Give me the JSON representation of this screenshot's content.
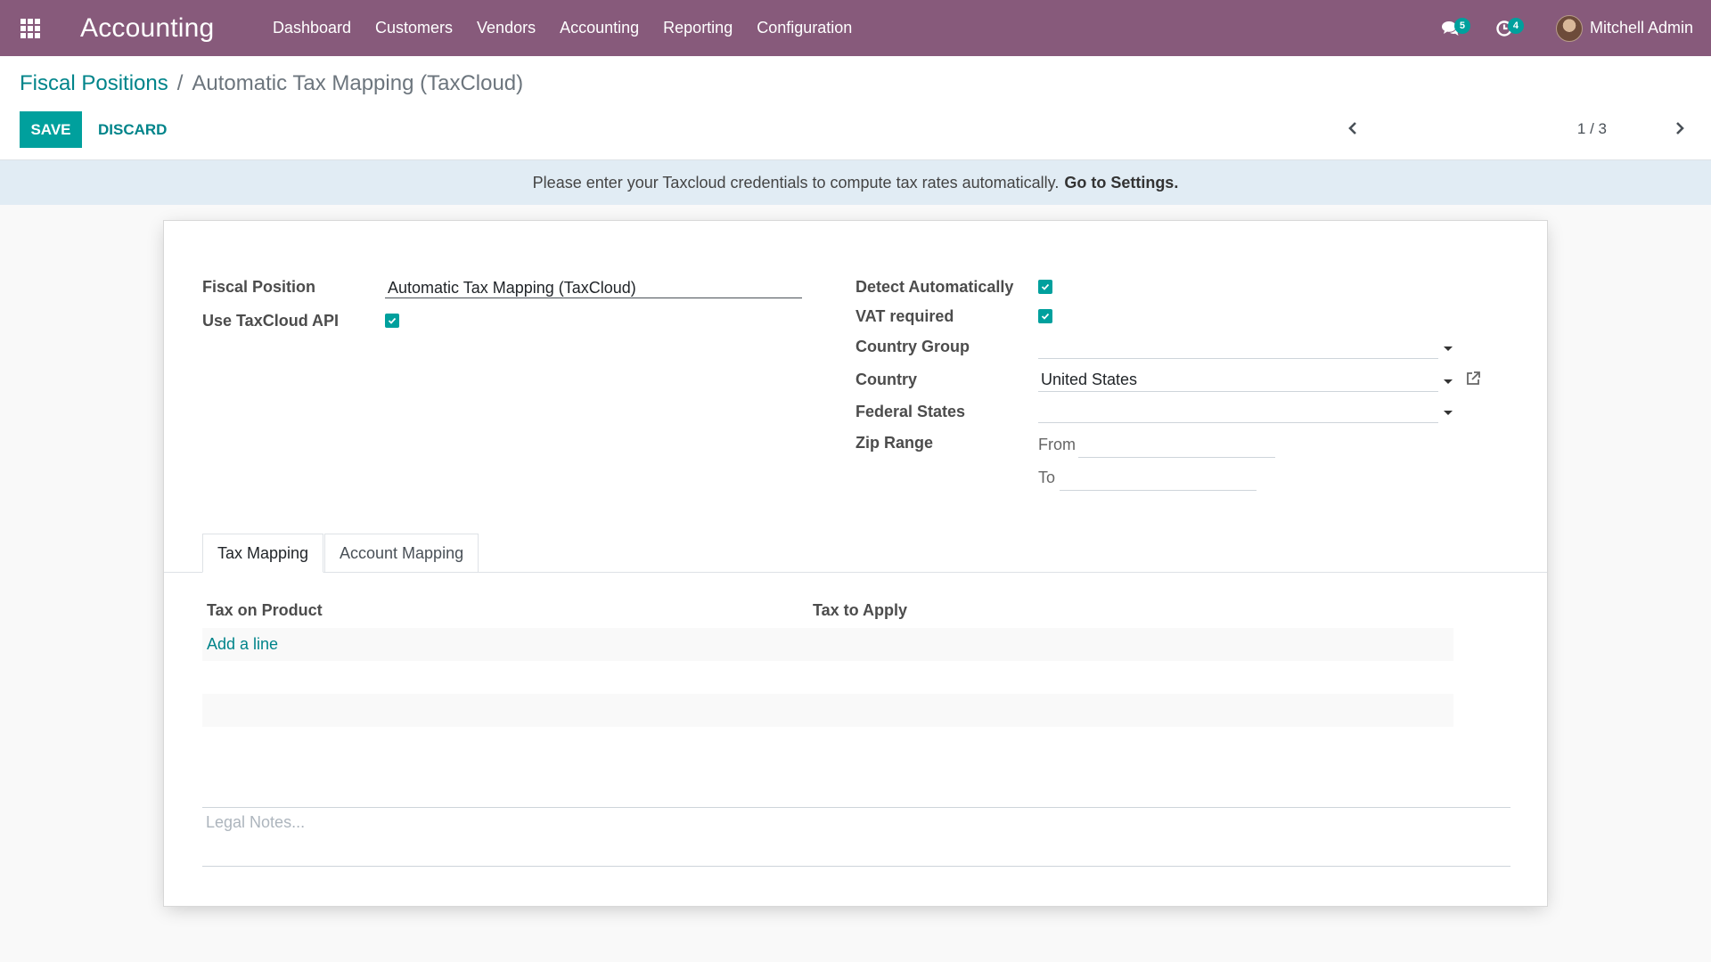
{
  "app": {
    "title": "Accounting"
  },
  "nav": {
    "menu": [
      "Dashboard",
      "Customers",
      "Vendors",
      "Accounting",
      "Reporting",
      "Configuration"
    ],
    "messages_count": "5",
    "activities_count": "4",
    "user_name": "Mitchell Admin"
  },
  "breadcrumb": {
    "parent": "Fiscal Positions",
    "separator": "/",
    "current": "Automatic Tax Mapping (TaxCloud)"
  },
  "toolbar": {
    "save_label": "SAVE",
    "discard_label": "DISCARD"
  },
  "pager": {
    "value": "1 / 3"
  },
  "alert": {
    "text": "Please enter your Taxcloud credentials to compute tax rates automatically.",
    "link": "Go to Settings."
  },
  "form": {
    "fiscal_position_label": "Fiscal Position",
    "fiscal_position_value": "Automatic Tax Mapping (TaxCloud)",
    "use_taxcloud_label": "Use TaxCloud API",
    "use_taxcloud_checked": true,
    "detect_auto_label": "Detect Automatically",
    "detect_auto_checked": true,
    "vat_required_label": "VAT required",
    "vat_required_checked": true,
    "country_group_label": "Country Group",
    "country_group_value": "",
    "country_label": "Country",
    "country_value": "United States",
    "federal_states_label": "Federal States",
    "federal_states_value": "",
    "zip_range_label": "Zip Range",
    "zip_from_label": "From",
    "zip_from_value": "",
    "zip_to_label": "To",
    "zip_to_value": ""
  },
  "tabs": [
    {
      "label": "Tax Mapping",
      "active": true
    },
    {
      "label": "Account Mapping",
      "active": false
    }
  ],
  "tax_table": {
    "headers": [
      "Tax on Product",
      "Tax to Apply"
    ],
    "add_line_label": "Add a line"
  },
  "notes": {
    "placeholder": "Legal Notes..."
  },
  "colors": {
    "navbar": "#875a7b",
    "primary": "#00a09d",
    "link": "#00848a",
    "alert_bg": "#e1ecf4"
  }
}
